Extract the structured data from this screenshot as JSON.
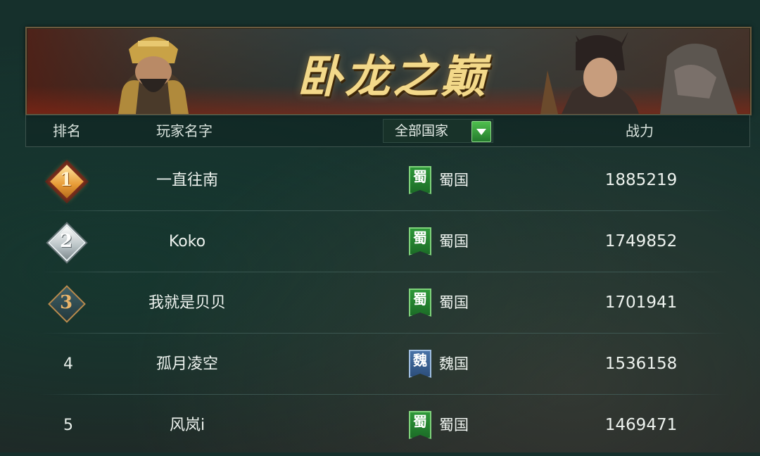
{
  "banner": {
    "title": "卧龙之巅"
  },
  "header": {
    "rank": "排名",
    "player_name": "玩家名字",
    "filter": "全部国家",
    "power": "战力"
  },
  "rows": [
    {
      "rank": "1",
      "name": "一直往南",
      "flag": "蜀",
      "country": "蜀国",
      "power": "1885219"
    },
    {
      "rank": "2",
      "name": "Koko",
      "flag": "蜀",
      "country": "蜀国",
      "power": "1749852"
    },
    {
      "rank": "3",
      "name": "我就是贝贝",
      "flag": "蜀",
      "country": "蜀国",
      "power": "1701941"
    },
    {
      "rank": "4",
      "name": "孤月凌空",
      "flag": "魏",
      "country": "魏国",
      "power": "1536158"
    },
    {
      "rank": "5",
      "name": "风岚i",
      "flag": "蜀",
      "country": "蜀国",
      "power": "1469471"
    }
  ],
  "colors": {
    "gold_title": "#f3d98a",
    "shu_green": "#2f9a3a",
    "wei_blue": "#4a74a8",
    "filter_green": "#4fbf4e"
  }
}
